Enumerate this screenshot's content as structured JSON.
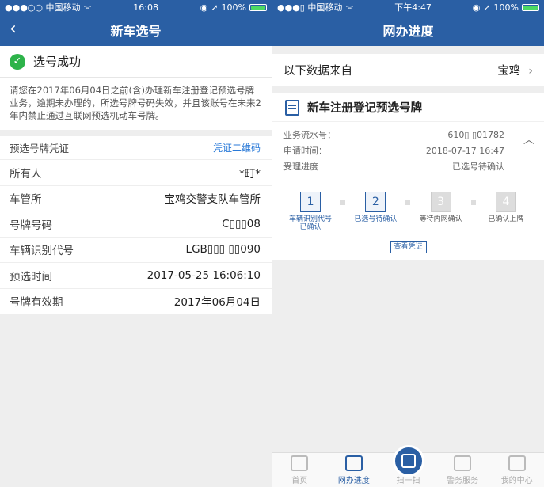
{
  "left": {
    "status": {
      "carrier": "●●●○○ 中国移动",
      "time": "16:08",
      "battery": "100%"
    },
    "title": "新车选号",
    "success_label": "选号成功",
    "notice": "请您在2017年06月04日之前(含)办理新车注册登记预选号牌业务，逾期未办理的，所选号牌号码失效，并且该账号在未来2年内禁止通过互联网预选机动车号牌。",
    "cert_label": "预选号牌凭证",
    "cert_link": "凭证二维码",
    "rows": [
      {
        "k": "所有人",
        "v": "*町*"
      },
      {
        "k": "车管所",
        "v": "宝鸡交警支队车管所"
      },
      {
        "k": "号牌号码",
        "v": "C▯▯▯08"
      },
      {
        "k": "车辆识别代号",
        "v": "LGB▯▯▯     ▯▯090"
      },
      {
        "k": "预选时间",
        "v": "2017-05-25 16:06:10"
      },
      {
        "k": "号牌有效期",
        "v": "2017年06月04日"
      }
    ]
  },
  "right": {
    "status": {
      "carrier": "●●●▯ 中国移动",
      "time": "下午4:47",
      "battery": "100%"
    },
    "title": "网办进度",
    "source_label": "以下数据来自",
    "source_value": "宝鸡",
    "card_title": "新车注册登记预选号牌",
    "info": [
      {
        "k": "业务流水号：",
        "v": "610▯         ▯01782"
      },
      {
        "k": "申请时间：",
        "v": "2018-07-17 16:47"
      },
      {
        "k": "受理进度",
        "v": "已选号待确认"
      }
    ],
    "steps": [
      {
        "n": "1",
        "label": "车辆识别代号已确认"
      },
      {
        "n": "2",
        "label": "已选号待确认"
      },
      {
        "n": "3",
        "label": "等待内网确认"
      },
      {
        "n": "4",
        "label": "已确认上牌"
      }
    ],
    "view_button": "查看凭证",
    "tabs": [
      {
        "label": "首页"
      },
      {
        "label": "网办进度"
      },
      {
        "label": "扫一扫"
      },
      {
        "label": "警务服务"
      },
      {
        "label": "我的中心"
      }
    ]
  },
  "colors": {
    "brand": "#2a5fa4",
    "success": "#2db34a",
    "link": "#2a7ad8"
  }
}
